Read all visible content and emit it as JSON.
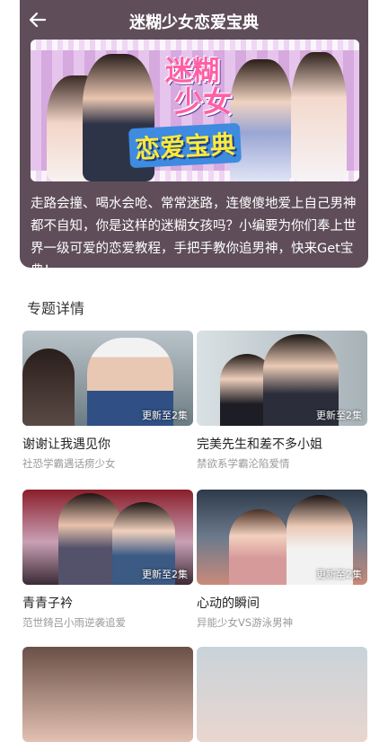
{
  "header": {
    "title": "迷糊少女恋爱宝典",
    "banner_line1": "迷糊",
    "banner_line2": "少女",
    "banner_line3": "恋爱宝典",
    "description": "走路会撞、喝水会呛、常常迷路，连傻傻地爱上自己男神都不自知，你是这样的迷糊女孩吗？小编要为你们奉上世界一级可爱的恋爱教程，手把手教你追男神，快来Get宝典！"
  },
  "section": {
    "title": "专题详情"
  },
  "cards": [
    {
      "title": "谢谢让我遇见你",
      "subtitle": "社恐学霸遇话痨少女",
      "badge": "更新至2集"
    },
    {
      "title": "完美先生和差不多小姐",
      "subtitle": "禁欲系学霸沦陷爱情",
      "badge": "更新至2集"
    },
    {
      "title": "青青子衿",
      "subtitle": "范世錡吕小雨逆袭追爱",
      "badge": "更新至2集"
    },
    {
      "title": "心动的瞬间",
      "subtitle": "异能少女VS游泳男神",
      "badge": "更新至2集"
    }
  ],
  "colors": {
    "header_bg": "#5f4e59",
    "banner_pink": "#ff5fa6",
    "banner_blue": "#3e8be0"
  }
}
